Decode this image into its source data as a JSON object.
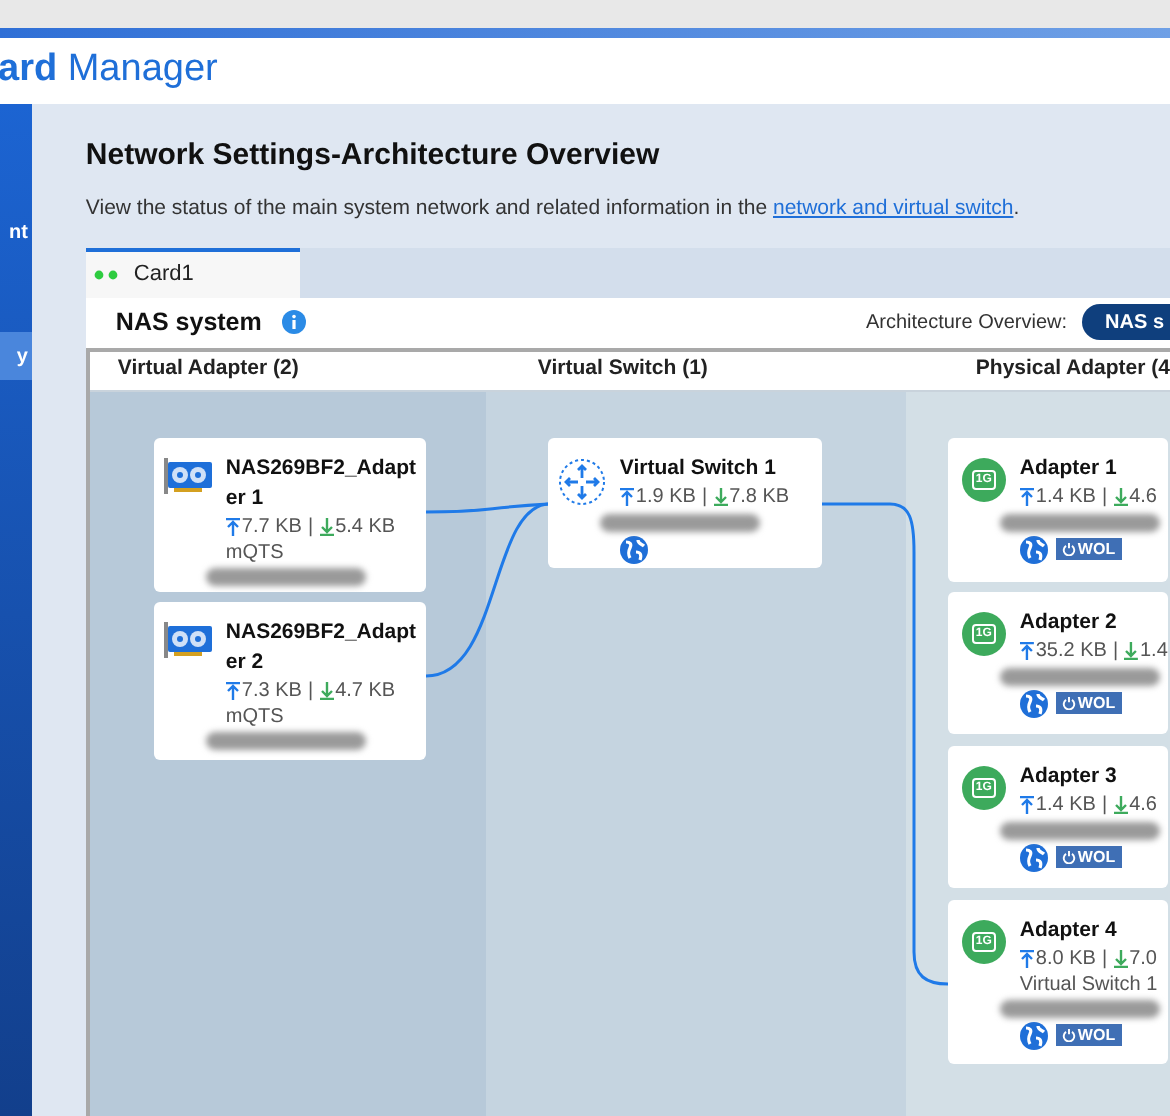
{
  "app": {
    "title_bold": "ard",
    "title": "Manager"
  },
  "sidebar": {
    "items": [
      {
        "label": "nt",
        "selected": false
      },
      {
        "label": "y",
        "selected": true
      }
    ]
  },
  "page": {
    "title": "Network Settings-Architecture Overview",
    "description": "View the status of the main system network and related information in the ",
    "link": "network and virtual switch",
    "description_end": "."
  },
  "tabs": [
    {
      "label": "Card1",
      "selected": true
    }
  ],
  "panel": {
    "title": "NAS system",
    "overview_label": "Architecture Overview:",
    "overview_button": "NAS s"
  },
  "columns": [
    {
      "label": "Virtual Adapter (2)"
    },
    {
      "label": "Virtual Switch (1)"
    },
    {
      "label": "Physical Adapter (4"
    }
  ],
  "traffic_separator": "|",
  "nodes": [
    {
      "kind": "virtual",
      "name": "NAS269BF2_Adapter 1",
      "up": "7.7 KB",
      "down": "5.4 KB",
      "note": "mQTS"
    },
    {
      "kind": "virtual",
      "name": "NAS269BF2_Adapter 2",
      "up": "7.3 KB",
      "down": "4.7 KB",
      "note": "mQTS"
    },
    {
      "kind": "switch",
      "name": "Virtual Switch 1",
      "up": "1.9 KB",
      "down": "7.8 KB"
    },
    {
      "kind": "physical",
      "name": "Adapter 1",
      "up": "1.4 KB",
      "down": "4.6",
      "port": "1G",
      "wol": "WOL"
    },
    {
      "kind": "physical",
      "name": "Adapter 2",
      "up": "35.2 KB",
      "down": "1.4",
      "port": "1G",
      "wol": "WOL"
    },
    {
      "kind": "physical",
      "name": "Adapter 3",
      "up": "1.4 KB",
      "down": "4.6",
      "port": "1G",
      "wol": "WOL"
    },
    {
      "kind": "physical",
      "name": "Adapter 4",
      "up": "8.0 KB",
      "down": "7.0",
      "note": "Virtual Switch 1",
      "port": "1G",
      "wol": "WOL"
    }
  ]
}
